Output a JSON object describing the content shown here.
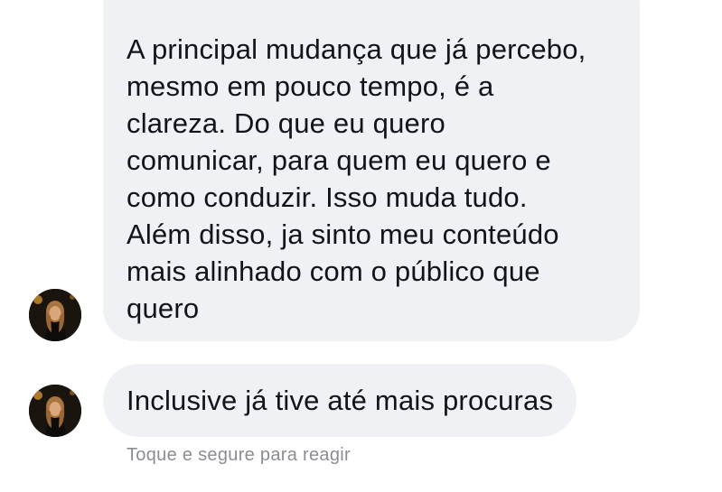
{
  "messages": [
    {
      "text": "A principal mudança que já percebo,\nmesmo em pouco tempo, é a\nclareza. Do que eu quero\ncomunicar, para quem eu quero e\ncomo conduzir. Isso muda tudo.\nAlém disso, ja sinto meu conteúdo\nmais alinhado com o público que\nquero"
    },
    {
      "text": "Inclusive já tive até mais procuras"
    }
  ],
  "reaction_hint": "Toque e segure para reagir",
  "colors": {
    "bubble_background": "#eff1f4",
    "bubble_text": "#111418",
    "hint_text": "#8a8d92"
  },
  "icons": {
    "avatar": "sender-profile-photo"
  }
}
